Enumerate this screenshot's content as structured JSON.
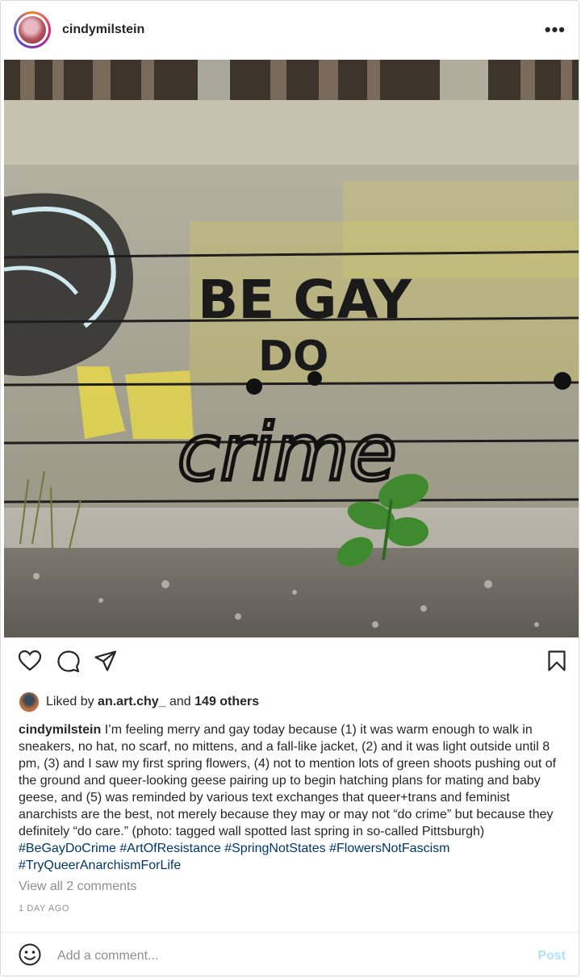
{
  "post": {
    "username": "cindymilstein",
    "more_label": "•••",
    "photo_text": {
      "line1": "BE GAY",
      "line2": "DO",
      "line3": "crime"
    },
    "likes": {
      "prefix": "Liked by",
      "user": "an.art.chy_",
      "conjunction": "and",
      "others": "149 others"
    },
    "caption": {
      "username": "cindymilstein",
      "text": " I’m feeling merry and gay today because (1) it was warm enough to walk in sneakers, no hat, no scarf, no mittens, and a fall-like jacket, (2) and it was light outside until 8 pm, (3) and I saw my first spring flowers, (4) not to mention lots of green shoots pushing out of the ground and queer-looking geese pairing up to begin hatching plans for mating and baby geese, and (5) was reminded by various text exchanges that queer+trans and feminist anarchists are the best, not merely because they may or may not “do crime” but because they definitely “do care.” (photo: tagged wall spotted last spring in so-called Pittsburgh) ",
      "hashtags": [
        "#BeGayDoCrime",
        "#ArtOfResistance",
        "#SpringNotStates",
        "#FlowersNotFascism",
        "#TryQueerAnarchismForLife"
      ]
    },
    "view_all_comments": "View all 2 comments",
    "time_ago": "1 DAY AGO",
    "comment_placeholder": "Add a comment...",
    "post_label": "Post",
    "colors": {
      "text": "#262626",
      "muted": "#8e8e8e",
      "hashtag": "#00376b",
      "post_disabled": "#b2dffc"
    }
  }
}
